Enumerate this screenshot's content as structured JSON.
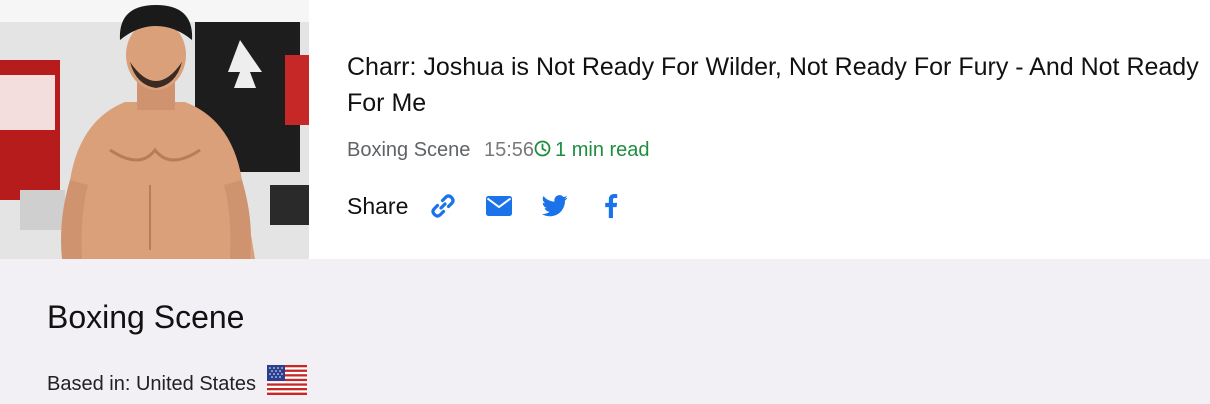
{
  "article": {
    "title": "Charr: Joshua is Not Ready For Wilder, Not Ready For Fury - And Not Ready For Me",
    "source": "Boxing Scene",
    "time": "15:56",
    "read_time": "1 min read",
    "thumbnail_icon": "boxer-photo",
    "clock_icon": "clock-icon"
  },
  "share": {
    "label": "Share",
    "buttons": [
      {
        "name": "copy-link",
        "icon": "link-icon"
      },
      {
        "name": "email",
        "icon": "envelope-icon"
      },
      {
        "name": "twitter",
        "icon": "twitter-icon"
      },
      {
        "name": "facebook",
        "icon": "facebook-icon"
      }
    ],
    "icon_color": "#1a73e8"
  },
  "source_info": {
    "name": "Boxing Scene",
    "based_in_label": "Based in: United States",
    "flag_icon": "us-flag-icon"
  },
  "colors": {
    "read_time": "#1e8e3e",
    "source_panel_bg": "#f2f0f4"
  }
}
